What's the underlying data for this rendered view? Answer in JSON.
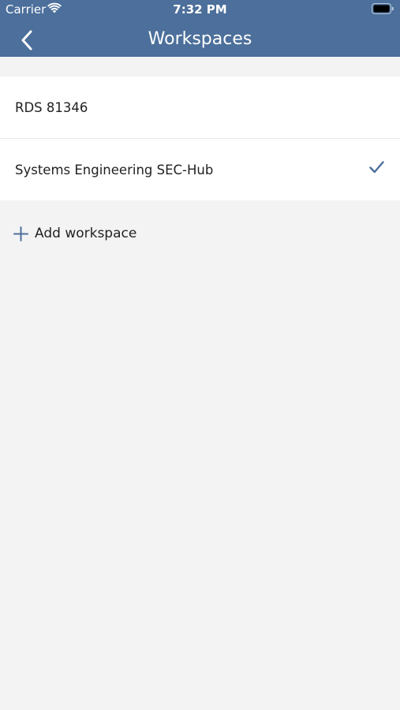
{
  "status_bar": {
    "carrier": "Carrier",
    "time": "7:32 PM",
    "wifi_icon": "wifi-icon",
    "battery_icon": "battery-icon"
  },
  "header": {
    "title": "Workspaces",
    "back_icon": "chevron-left-icon",
    "background_color": "#4c6f9b"
  },
  "workspaces": [
    {
      "name": "RDS 81346",
      "selected": false
    },
    {
      "name": "Systems Engineering SEC-Hub",
      "selected": true
    }
  ],
  "add_workspace": {
    "label": "Add workspace",
    "icon": "plus-icon"
  },
  "colors": {
    "accent": "#4c6f9b",
    "background": "#f3f3f3",
    "row_background": "#ffffff"
  }
}
